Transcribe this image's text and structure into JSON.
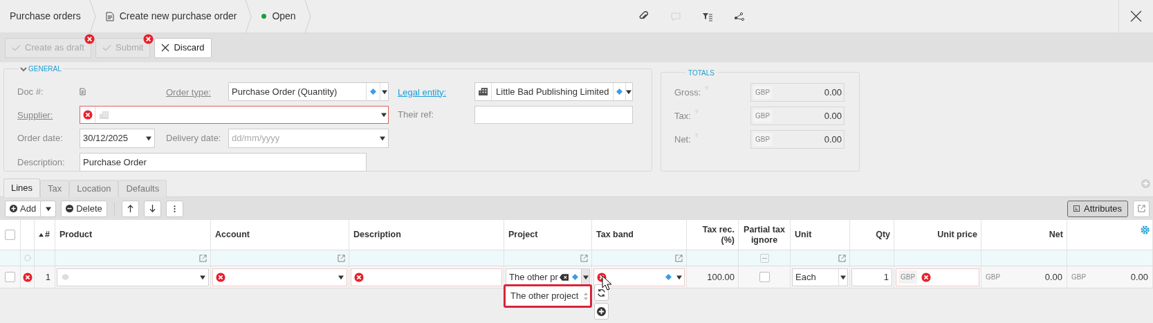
{
  "breadcrumbs": [
    {
      "label": "Purchase orders",
      "kind": "plain"
    },
    {
      "label": "Create new purchase order",
      "kind": "document"
    },
    {
      "label": "Open",
      "kind": "status",
      "color": "#1a9e3a"
    }
  ],
  "header_tools": [
    {
      "kind": "attachment",
      "disabled": false
    },
    {
      "kind": "comment",
      "disabled": true
    },
    {
      "kind": "filter",
      "disabled": false
    },
    {
      "kind": "workflow",
      "disabled": false
    }
  ],
  "actions": [
    {
      "label": "Create as draft",
      "kind": "confirm",
      "disabled": true,
      "error": true
    },
    {
      "label": "Submit",
      "kind": "confirm",
      "disabled": true,
      "error": true
    },
    {
      "label": "Discard",
      "kind": "cancel",
      "disabled": false,
      "error": false
    }
  ],
  "general": {
    "title": "GENERAL",
    "expanded": true,
    "doc": {
      "label": "Doc #:"
    },
    "order_type": {
      "label": "Order type:",
      "value": "Purchase Order (Quantity)",
      "link": false
    },
    "legal_entity": {
      "label": "Legal entity:",
      "value": "Little Bad Publishing Limited",
      "link": true
    },
    "supplier": {
      "label": "Supplier:",
      "error": true
    },
    "their_ref": {
      "label": "Their ref:"
    },
    "order_date": {
      "label": "Order date:",
      "value": "30/12/2025"
    },
    "delivery_date": {
      "label": "Delivery date:",
      "placeholder": "dd/mm/yyyy"
    },
    "description": {
      "label": "Description:",
      "value": "Purchase Order"
    }
  },
  "totals": {
    "title": "TOTALS",
    "rows": [
      {
        "label": "Gross:",
        "hint": "?",
        "currency": "GBP",
        "value": "0.00"
      },
      {
        "label": "Tax:",
        "hint": "?",
        "currency": "GBP",
        "value": "0.00"
      },
      {
        "label": "Net:",
        "hint": "?",
        "currency": "GBP",
        "value": "0.00"
      }
    ]
  },
  "tabs": [
    {
      "label": "Lines",
      "selected": true
    },
    {
      "label": "Tax",
      "selected": false
    },
    {
      "label": "Location",
      "selected": false
    },
    {
      "label": "Defaults",
      "selected": false
    }
  ],
  "lines_toolbar": {
    "add": "Add",
    "delete": "Delete",
    "attributes": "Attributes"
  },
  "table": {
    "columns": [
      {
        "kind": "select",
        "checked": false
      },
      {
        "kind": "status",
        "pending_filter": true
      },
      {
        "kind": "index",
        "label": "#",
        "sort_ascending": true
      },
      {
        "kind": "text",
        "label": "Product",
        "open_filter": true
      },
      {
        "kind": "text",
        "label": "Account",
        "open_filter": true
      },
      {
        "kind": "text",
        "label": "Description"
      },
      {
        "kind": "text",
        "label": "Project",
        "open_filter": true
      },
      {
        "kind": "text",
        "label": "Tax band",
        "open_filter": true
      },
      {
        "kind": "number",
        "label": "Tax rec. (%)"
      },
      {
        "kind": "center",
        "label": "Partial tax ignore",
        "clear_filter": true
      },
      {
        "kind": "text",
        "label": "Unit",
        "open_filter": true
      },
      {
        "kind": "number",
        "label": "Qty"
      },
      {
        "kind": "number",
        "label": "Unit price"
      },
      {
        "kind": "number",
        "label": "Net"
      },
      {
        "kind": "number"
      }
    ],
    "rows": [
      {
        "checked": false,
        "error": true,
        "number": "1",
        "product_error": false,
        "account_error": true,
        "description_error": true,
        "project": "The other pr",
        "tax_band_error": true,
        "tax_rec": "100.00",
        "partial_tax_ignore": false,
        "unit": "Each",
        "qty": "1",
        "unit_price_currency": "GBP",
        "unit_price_error": true,
        "net_currency": "GBP",
        "net": "0.00",
        "column_15_currency": "GBP",
        "column_15": "0.00"
      }
    ]
  },
  "project_dropdown": {
    "options": [
      {
        "label": "The other project",
        "selected": false
      }
    ]
  }
}
